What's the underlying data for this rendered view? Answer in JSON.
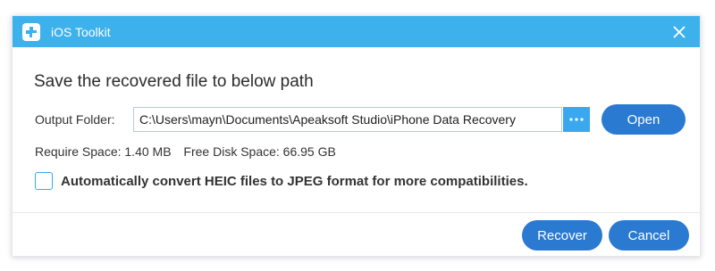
{
  "window": {
    "title": "iOS Toolkit",
    "icons": {
      "app": "app-logo-icon",
      "close": "close-icon"
    }
  },
  "dialog": {
    "heading": "Save the recovered file to below path",
    "output_folder": {
      "label": "Output Folder:",
      "value": "C:\\Users\\mayn\\Documents\\Apeaksoft Studio\\iPhone Data Recovery",
      "browse_icon": "ellipsis-icon",
      "open_label": "Open"
    },
    "require_space": "Require Space: 1.40 MB",
    "free_space": "Free Disk Space: 66.95 GB",
    "heic_option": {
      "label": "Automatically convert HEIC files to JPEG format for more compatibilities.",
      "checked": false
    }
  },
  "footer": {
    "recover_label": "Recover",
    "cancel_label": "Cancel"
  },
  "colors": {
    "titlebar": "#3db1ec",
    "button": "#2a7ad1",
    "browse": "#3aa8ee"
  }
}
